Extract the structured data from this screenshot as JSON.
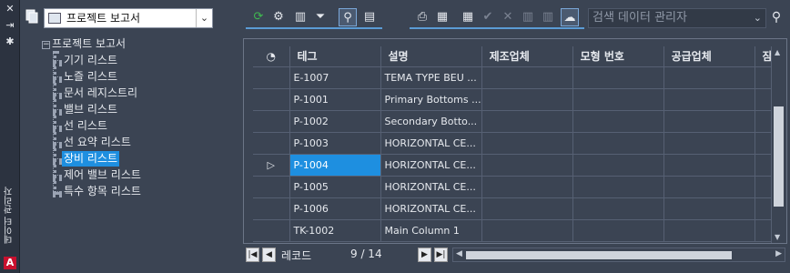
{
  "palette": {
    "title": "데이터 관리자",
    "icons": [
      "close-icon",
      "autohide-icon",
      "settings-icon",
      "autocad-logo-icon"
    ],
    "logo_letter": "A"
  },
  "project": {
    "selected": "프로젝트 보고서"
  },
  "tree": {
    "root": "프로젝트 보고서",
    "items": [
      {
        "label": "기기 리스트",
        "selected": false
      },
      {
        "label": "노즐 리스트",
        "selected": false
      },
      {
        "label": "문서 레지스트리",
        "selected": false
      },
      {
        "label": "밸브 리스트",
        "selected": false
      },
      {
        "label": "선 리스트",
        "selected": false
      },
      {
        "label": "선 요약 리스트",
        "selected": false
      },
      {
        "label": "장비 리스트",
        "selected": true
      },
      {
        "label": "제어 밸브 리스트",
        "selected": false
      },
      {
        "label": "특수 항목 리스트",
        "selected": false
      }
    ]
  },
  "toolbar": {
    "search_placeholder": "검색 데이터 관리자",
    "icons": [
      "refresh-icon",
      "filter-link-icon",
      "column-icon",
      "clear-filter-icon",
      "zoom-icon",
      "hide-icon",
      "print-icon",
      "export-icon",
      "import-icon",
      "accept-icon",
      "reject-icon",
      "accept-all-icon",
      "reject-all-icon",
      "cloud-icon",
      "search-icon"
    ]
  },
  "grid": {
    "columns": [
      "테그",
      "설명",
      "제조업체",
      "모형 번호",
      "공급업체",
      "잠"
    ],
    "rows": [
      {
        "tag": "E-1007",
        "desc": "TEMA TYPE BEU ..."
      },
      {
        "tag": "P-1001",
        "desc": "Primary Bottoms ..."
      },
      {
        "tag": "P-1002",
        "desc": "Secondary Botto..."
      },
      {
        "tag": "P-1003",
        "desc": "HORIZONTAL CE..."
      },
      {
        "tag": "P-1004",
        "desc": "HORIZONTAL CE..."
      },
      {
        "tag": "P-1005",
        "desc": "HORIZONTAL CE..."
      },
      {
        "tag": "P-1006",
        "desc": "HORIZONTAL CE..."
      },
      {
        "tag": "TK-1002",
        "desc": "Main Column 1"
      }
    ],
    "current_row": 4
  },
  "footer": {
    "record_label": "레코드",
    "record_count": "9 / 14"
  }
}
